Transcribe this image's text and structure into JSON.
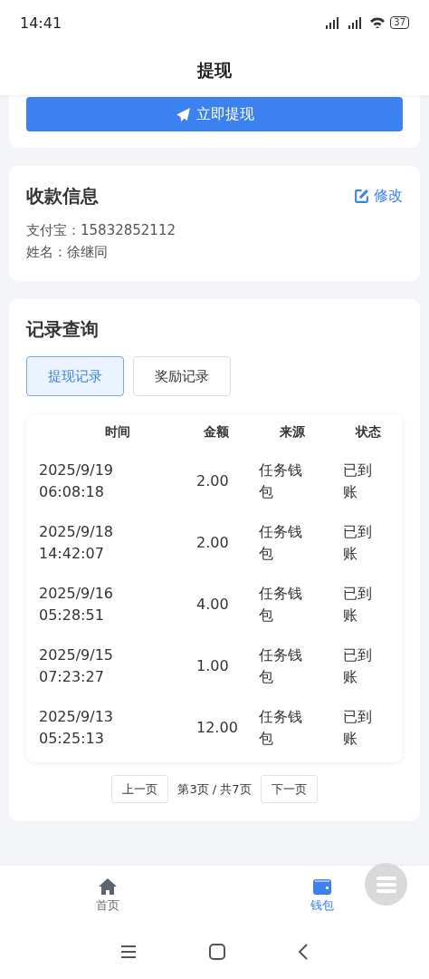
{
  "status_bar": {
    "time": "14:41",
    "battery": "37"
  },
  "header": {
    "title": "提现"
  },
  "withdraw_button": {
    "label": "立即提现"
  },
  "payee_card": {
    "title": "收款信息",
    "edit_link": "修改",
    "lines": [
      "支付宝：15832852112",
      "姓名：徐继同"
    ]
  },
  "records_card": {
    "title": "记录查询",
    "tabs": [
      {
        "label": "提现记录",
        "selected": true
      },
      {
        "label": "奖励记录",
        "selected": false
      }
    ],
    "table": {
      "columns": [
        "时间",
        "金额",
        "来源",
        "状态"
      ],
      "rows": [
        [
          "2025/9/19 06:08:18",
          "2.00",
          "任务钱包",
          "已到账"
        ],
        [
          "2025/9/18 14:42:07",
          "2.00",
          "任务钱包",
          "已到账"
        ],
        [
          "2025/9/16 05:28:51",
          "4.00",
          "任务钱包",
          "已到账"
        ],
        [
          "2025/9/15 07:23:27",
          "1.00",
          "任务钱包",
          "已到账"
        ],
        [
          "2025/9/13 05:25:13",
          "12.00",
          "任务钱包",
          "已到账"
        ]
      ]
    },
    "pagination": {
      "prev": "上一页",
      "info": "第3页 / 共7页",
      "next": "下一页"
    }
  },
  "bottom_nav": [
    {
      "label": "首页",
      "selected": false
    },
    {
      "label": "钱包",
      "selected": true
    }
  ]
}
